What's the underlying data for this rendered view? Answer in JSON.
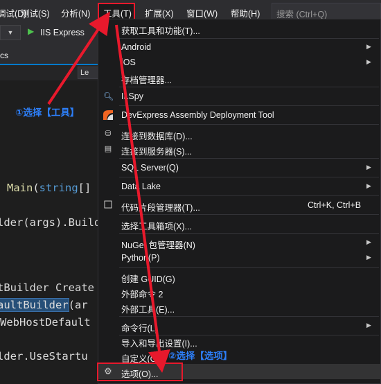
{
  "menubar": {
    "items": [
      {
        "label": "调试(D)"
      },
      {
        "label": "测试(S)"
      },
      {
        "label": "分析(N)"
      },
      {
        "label": "工具(T)"
      },
      {
        "label": "扩展(X)"
      },
      {
        "label": "窗口(W)"
      },
      {
        "label": "帮助(H)"
      }
    ],
    "search_placeholder": "搜索 (Ctrl+Q)"
  },
  "toolbar": {
    "dropdown_arrow": "▼",
    "run_label": "IIS Express"
  },
  "editor": {
    "tab_label": "cs",
    "nav_combo": "Le",
    "code_lines": [
      {
        "parts": [
          [
            "Main",
            "fn"
          ],
          [
            "(",
            "p"
          ],
          [
            "string",
            "kw"
          ],
          [
            "[]",
            "p"
          ]
        ]
      },
      {
        "parts": [
          [
            "lder(args).Build",
            "p"
          ]
        ]
      },
      {
        "parts": [
          [
            "tBuilder Create",
            "p"
          ]
        ]
      },
      {
        "parts": [
          [
            "aultBuilder",
            "hl"
          ],
          [
            "(ar",
            "p"
          ]
        ]
      },
      {
        "parts": [
          [
            "WebHostDefault",
            "p"
          ]
        ]
      },
      {
        "parts": [
          [
            "lder.UseStartu",
            "p"
          ]
        ]
      }
    ]
  },
  "menu": {
    "items": [
      {
        "label": "获取工具和功能(T)...",
        "icon": "",
        "shortcut": "",
        "arrow": false
      },
      {
        "label": "Android",
        "icon": "",
        "shortcut": "",
        "arrow": true
      },
      {
        "label": "iOS",
        "icon": "",
        "shortcut": "",
        "arrow": true
      },
      {
        "label": "存档管理器...",
        "icon": "",
        "shortcut": "",
        "arrow": false
      },
      {
        "label": "ILSpy",
        "icon": "ilspy-icon",
        "shortcut": "",
        "arrow": false
      },
      {
        "label": "DevExpress Assembly Deployment Tool",
        "icon": "devexpress-icon",
        "shortcut": "",
        "arrow": false
      },
      {
        "label": "连接到数据库(D)...",
        "icon": "database-connect-icon",
        "shortcut": "",
        "arrow": false
      },
      {
        "label": "连接到服务器(S)...",
        "icon": "server-connect-icon",
        "shortcut": "",
        "arrow": false
      },
      {
        "label": "SQL Server(Q)",
        "icon": "",
        "shortcut": "",
        "arrow": true
      },
      {
        "label": "Data Lake",
        "icon": "",
        "shortcut": "",
        "arrow": true
      },
      {
        "label": "代码片段管理器(T)...",
        "icon": "snippet-icon",
        "shortcut": "Ctrl+K, Ctrl+B",
        "arrow": false
      },
      {
        "label": "选择工具箱项(X)...",
        "icon": "",
        "shortcut": "",
        "arrow": false
      },
      {
        "label": "NuGet 包管理器(N)",
        "icon": "",
        "shortcut": "",
        "arrow": true
      },
      {
        "label": "Python(P)",
        "icon": "",
        "shortcut": "",
        "arrow": true
      },
      {
        "label": "创建 GUID(G)",
        "icon": "",
        "shortcut": "",
        "arrow": false
      },
      {
        "label": "外部命令 2",
        "icon": "",
        "shortcut": "",
        "arrow": false
      },
      {
        "label": "外部工具(E)...",
        "icon": "",
        "shortcut": "",
        "arrow": false
      },
      {
        "label": "命令行(L)",
        "icon": "",
        "shortcut": "",
        "arrow": true
      },
      {
        "label": "导入和导出设置(I)...",
        "icon": "",
        "shortcut": "",
        "arrow": false
      },
      {
        "label": "自定义(C)...",
        "icon": "",
        "shortcut": "",
        "arrow": false
      },
      {
        "label": "选项(O)...",
        "icon": "gear-icon",
        "shortcut": "",
        "arrow": false
      }
    ]
  },
  "annotations": {
    "step1": "①选择【工具】",
    "step2": "②选择【选项】"
  },
  "colors": {
    "highlight": "#e8192c",
    "annotation": "#2d7ff9",
    "menu_bg": "#1b1b1c"
  }
}
